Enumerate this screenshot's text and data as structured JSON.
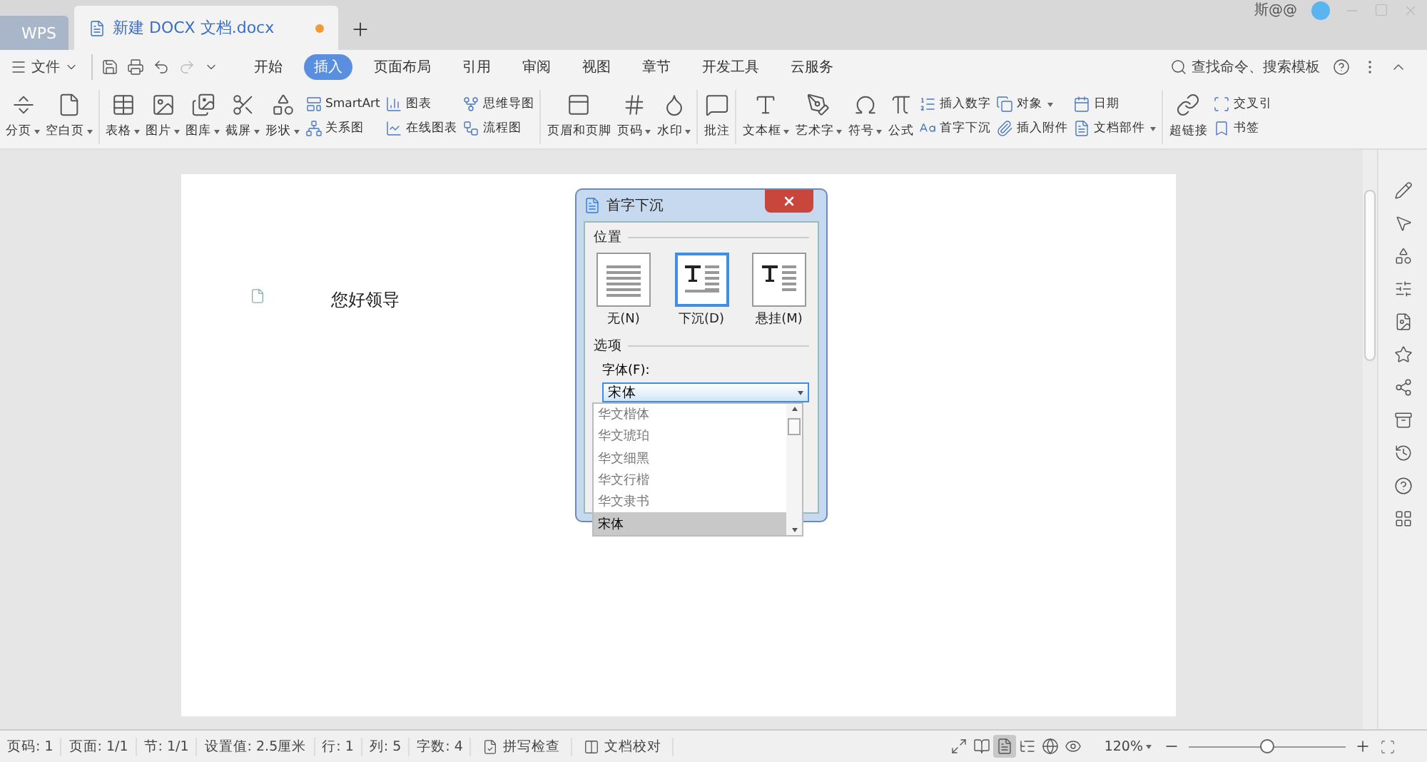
{
  "title_bar": {
    "tabs": [
      {
        "label": "WPS",
        "selected": false
      },
      {
        "label": "新建 DOCX 文档.docx",
        "selected": true,
        "unsaved": true
      }
    ],
    "user": "斯@@"
  },
  "menu": {
    "file": "文件",
    "tabs": [
      {
        "label": "开始",
        "selected": false
      },
      {
        "label": "插入",
        "selected": true
      },
      {
        "label": "页面布局",
        "selected": false
      },
      {
        "label": "引用",
        "selected": false
      },
      {
        "label": "审阅",
        "selected": false
      },
      {
        "label": "视图",
        "selected": false
      },
      {
        "label": "章节",
        "selected": false
      },
      {
        "label": "开发工具",
        "selected": false
      },
      {
        "label": "云服务",
        "selected": false
      }
    ],
    "search": "查找命令、搜索模板"
  },
  "ribbon": [
    {
      "kind": "large",
      "label": "分页",
      "dropdown": true
    },
    {
      "kind": "large",
      "label": "空白页",
      "dropdown": true
    },
    {
      "kind": "sep"
    },
    {
      "kind": "large",
      "label": "表格",
      "dropdown": true
    },
    {
      "kind": "large",
      "label": "图片",
      "dropdown": true
    },
    {
      "kind": "large",
      "label": "图库",
      "dropdown": true
    },
    {
      "kind": "large",
      "label": "截屏",
      "dropdown": true
    },
    {
      "kind": "large",
      "label": "形状",
      "dropdown": true
    },
    {
      "kind": "stack",
      "items": [
        {
          "label": "SmartArt",
          "dropdown": false
        },
        {
          "label": "关系图",
          "dropdown": false
        }
      ]
    },
    {
      "kind": "stack",
      "items": [
        {
          "label": "图表",
          "dropdown": false
        },
        {
          "label": "在线图表",
          "dropdown": false
        }
      ]
    },
    {
      "kind": "stack",
      "items": [
        {
          "label": "思维导图",
          "dropdown": false
        },
        {
          "label": "流程图",
          "dropdown": false
        }
      ]
    },
    {
      "kind": "sep"
    },
    {
      "kind": "large",
      "label": "页眉和页脚",
      "dropdown": false
    },
    {
      "kind": "large",
      "label": "页码",
      "dropdown": true
    },
    {
      "kind": "large",
      "label": "水印",
      "dropdown": true
    },
    {
      "kind": "sep"
    },
    {
      "kind": "large",
      "label": "批注",
      "dropdown": false
    },
    {
      "kind": "sep"
    },
    {
      "kind": "large",
      "label": "文本框",
      "dropdown": true
    },
    {
      "kind": "large",
      "label": "艺术字",
      "dropdown": true
    },
    {
      "kind": "large",
      "label": "符号",
      "dropdown": true
    },
    {
      "kind": "large",
      "label": "公式",
      "dropdown": false
    },
    {
      "kind": "stack",
      "items": [
        {
          "label": "插入数字",
          "dropdown": false
        },
        {
          "label": "首字下沉",
          "dropdown": false
        }
      ]
    },
    {
      "kind": "stack",
      "items": [
        {
          "label": "对象",
          "dropdown": true
        },
        {
          "label": "插入附件",
          "dropdown": false
        }
      ]
    },
    {
      "kind": "stack",
      "items": [
        {
          "label": "日期",
          "dropdown": false
        },
        {
          "label": "文档部件",
          "dropdown": true
        }
      ]
    },
    {
      "kind": "sep"
    },
    {
      "kind": "large",
      "label": "超链接",
      "dropdown": false
    },
    {
      "kind": "stack",
      "items": [
        {
          "label": "交叉引",
          "dropdown": false
        },
        {
          "label": "书签",
          "dropdown": false
        }
      ]
    }
  ],
  "document": {
    "text": "您好领导"
  },
  "dialog": {
    "title": "首字下沉",
    "position_label": "位置",
    "positions": [
      {
        "label": "无(N)",
        "selected": false
      },
      {
        "label": "下沉(D)",
        "selected": true
      },
      {
        "label": "悬挂(M)",
        "selected": false
      }
    ],
    "options_label": "选项",
    "font_label": "字体(F):",
    "font_value": "宋体",
    "font_list": [
      {
        "label": "华文楷体",
        "selected": false
      },
      {
        "label": "华文琥珀",
        "selected": false
      },
      {
        "label": "华文细黑",
        "selected": false
      },
      {
        "label": "华文行楷",
        "selected": false
      },
      {
        "label": "华文隶书",
        "selected": false
      },
      {
        "label": "宋体",
        "selected": true
      }
    ]
  },
  "status_bar": {
    "items": [
      "页码: 1",
      "页面: 1/1",
      "节: 1/1",
      "设置值: 2.5厘米",
      "行: 1",
      "列: 5",
      "字数: 4"
    ],
    "buttons": [
      "拼写检查",
      "文档校对"
    ],
    "views": [
      {
        "selected": false
      },
      {
        "selected": false
      },
      {
        "selected": true
      },
      {
        "selected": false
      },
      {
        "selected": false
      },
      {
        "selected": false
      }
    ],
    "zoom": "120%",
    "zoom_slider": {
      "level": 0.5
    }
  }
}
